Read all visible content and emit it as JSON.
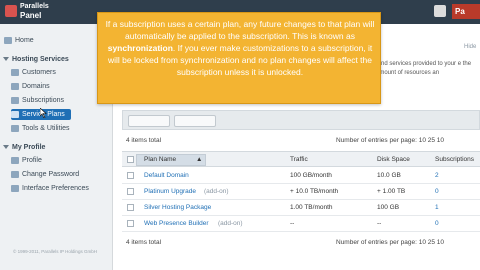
{
  "header": {
    "logo_line1": "Parallels",
    "logo_line2": "Panel",
    "brand_short": "Pa"
  },
  "sidebar": {
    "home_label": "Home",
    "hosting_services_heading": "Hosting Services",
    "hosting_items": [
      {
        "label": "Customers"
      },
      {
        "label": "Domains"
      },
      {
        "label": "Subscriptions"
      },
      {
        "label": "Service Plans"
      },
      {
        "label": "Tools & Utilities"
      }
    ],
    "my_profile_heading": "My Profile",
    "profile_items": [
      {
        "label": "Profile"
      },
      {
        "label": "Change Password"
      },
      {
        "label": "Interface Preferences"
      }
    ],
    "footer": "© 1999-2011, Parallels IP Holdings GmbH"
  },
  "content": {
    "hint_small": "Hide",
    "hint_text": "fend services provided to your e the amount of resources an",
    "items_total": "4 items total",
    "entries_per_page": "Number of entries per page: 10 25 10",
    "columns": [
      "Plan Name",
      "Traffic",
      "Disk Space",
      "Subscriptions"
    ],
    "rows": [
      {
        "name": "Default Domain",
        "addon": "",
        "traffic": "100 GB/month",
        "disk": "10.0 GB",
        "subs": "2"
      },
      {
        "name": "Platinum Upgrade",
        "addon": "(add-on)",
        "traffic": "+ 10.0 TB/month",
        "disk": "+ 1.00 TB",
        "subs": "0"
      },
      {
        "name": "Silver Hosting Package",
        "addon": "",
        "traffic": "1.00 TB/month",
        "disk": "100 GB",
        "subs": "1"
      },
      {
        "name": "Web Presence Builder",
        "addon": "(add-on)",
        "traffic": "--",
        "disk": "--",
        "subs": "0"
      }
    ]
  },
  "tooltip": {
    "text_before": "If a subscription uses a certain plan, any future changes to that plan will automatically be applied to the subscription. This is known as ",
    "bold_word": "synchronization",
    "text_after": ". If you ever make customizations to a subscription, it will be locked from synchronization and no plan changes will affect the subscription unless it is unlocked."
  },
  "colors": {
    "topbar": "#2f3e4c",
    "sidebar": "#eef1f3",
    "active_nav": "#1f6fb5",
    "tooltip": "#f3b432",
    "link": "#1f6fb5"
  }
}
